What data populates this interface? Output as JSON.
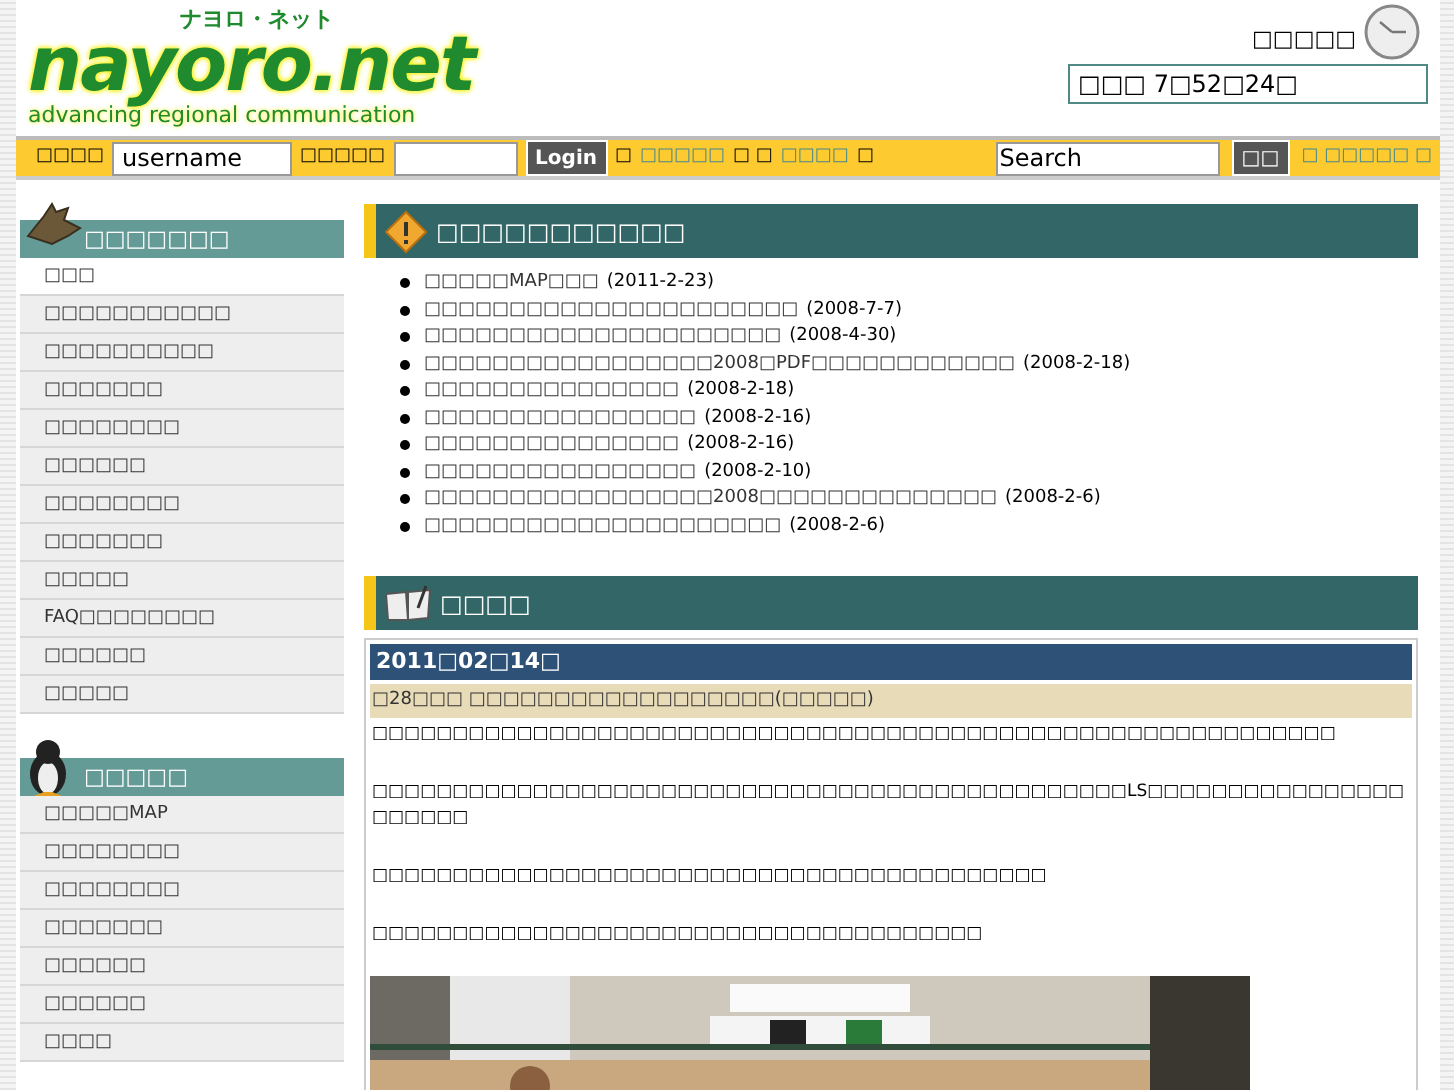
{
  "logo": {
    "kana": "ナヨロ・ネット",
    "name": "nayoro.net",
    "tagline": "advancing regional communication"
  },
  "clock": {
    "label": "□□□□□",
    "time": "□□□ 7□52□24□"
  },
  "login_bar": {
    "user_label": "□□□□",
    "username": "username",
    "password_label": "□□□□□",
    "login_button": "Login",
    "links_before": "□",
    "link_1": "□□□□□",
    "links_mid": "□ □",
    "link_2": "□□□□",
    "links_after": "□",
    "search_value": "Search",
    "search_button": "□□",
    "right_link_open": "□",
    "right_link": "□□□□□",
    "right_link_close": "□"
  },
  "menus": [
    {
      "title": "□□□□□□□",
      "items": [
        {
          "label": "□□□",
          "selected": true
        },
        {
          "label": "□□□□□□□□□□□",
          "selected": false
        },
        {
          "label": "□□□□□□□□□□",
          "selected": false
        },
        {
          "label": "□□□□□□□",
          "selected": false
        },
        {
          "label": "□□□□□□□□",
          "selected": false
        },
        {
          "label": "□□□□□□",
          "selected": false
        },
        {
          "label": "□□□□□□□□",
          "selected": false
        },
        {
          "label": "□□□□□□□",
          "selected": false
        },
        {
          "label": "□□□□□",
          "selected": false
        },
        {
          "label": "FAQ□□□□□□□□",
          "selected": false
        },
        {
          "label": "□□□□□□",
          "selected": false
        },
        {
          "label": "□□□□□",
          "selected": false
        }
      ]
    },
    {
      "title": "□□□□□",
      "items": [
        {
          "label": "□□□□□MAP",
          "selected": false
        },
        {
          "label": "□□□□□□□□",
          "selected": false
        },
        {
          "label": "□□□□□□□□",
          "selected": false
        },
        {
          "label": "□□□□□□□",
          "selected": false
        },
        {
          "label": "□□□□□□",
          "selected": false
        },
        {
          "label": "□□□□□□",
          "selected": false
        },
        {
          "label": "□□□□",
          "selected": false
        }
      ]
    }
  ],
  "news": {
    "title": "□□□□□□□□□□□",
    "items": [
      {
        "text": "□□□□□MAP□□□",
        "date": "(2011-2-23)"
      },
      {
        "text": "□□□□□□□□□□□□□□□□□□□□□□",
        "date": "(2008-7-7)"
      },
      {
        "text": "□□□□□□□□□□□□□□□□□□□□□",
        "date": "(2008-4-30)"
      },
      {
        "text": "□□□□□□□□□□□□□□□□□2008□PDF□□□□□□□□□□□□",
        "date": "(2008-2-18)"
      },
      {
        "text": "□□□□□□□□□□□□□□□",
        "date": "(2008-2-18)"
      },
      {
        "text": "□□□□□□□□□□□□□□□□",
        "date": "(2008-2-16)"
      },
      {
        "text": "□□□□□□□□□□□□□□□",
        "date": "(2008-2-16)"
      },
      {
        "text": "□□□□□□□□□□□□□□□□",
        "date": "(2008-2-10)"
      },
      {
        "text": "□□□□□□□□□□□□□□□□□2008□□□□□□□□□□□□□□",
        "date": "(2008-2-6)"
      },
      {
        "text": "□□□□□□□□□□□□□□□□□□□□□",
        "date": "(2008-2-6)"
      }
    ]
  },
  "diary": {
    "title": "□□□□",
    "date": "2011□02□14□",
    "entry_title": "□28□□□ □□□□□□□□□□□□□□□□□□(□□□□□)",
    "paragraphs": [
      "□□□□□□□□□□□□□□□□□□□□□□□□□□□□□□□□□□□□□□□□□□□□□□□□□□□□□□□□□□□□",
      "□□□□□□□□□□□□□□□□□□□□□□□□□□□□□□□□□□□□□□□□□□□□□□□LS□□□□□□□□□□□□□□□□□□□□□□",
      "□□□□□□□□□□□□□□□□□□□□□□□□□□□□□□□□□□□□□□□□□□",
      "□□□□□□□□□□□□□□□□□□□□□□□□□□□□□□□□□□□□□□"
    ]
  }
}
